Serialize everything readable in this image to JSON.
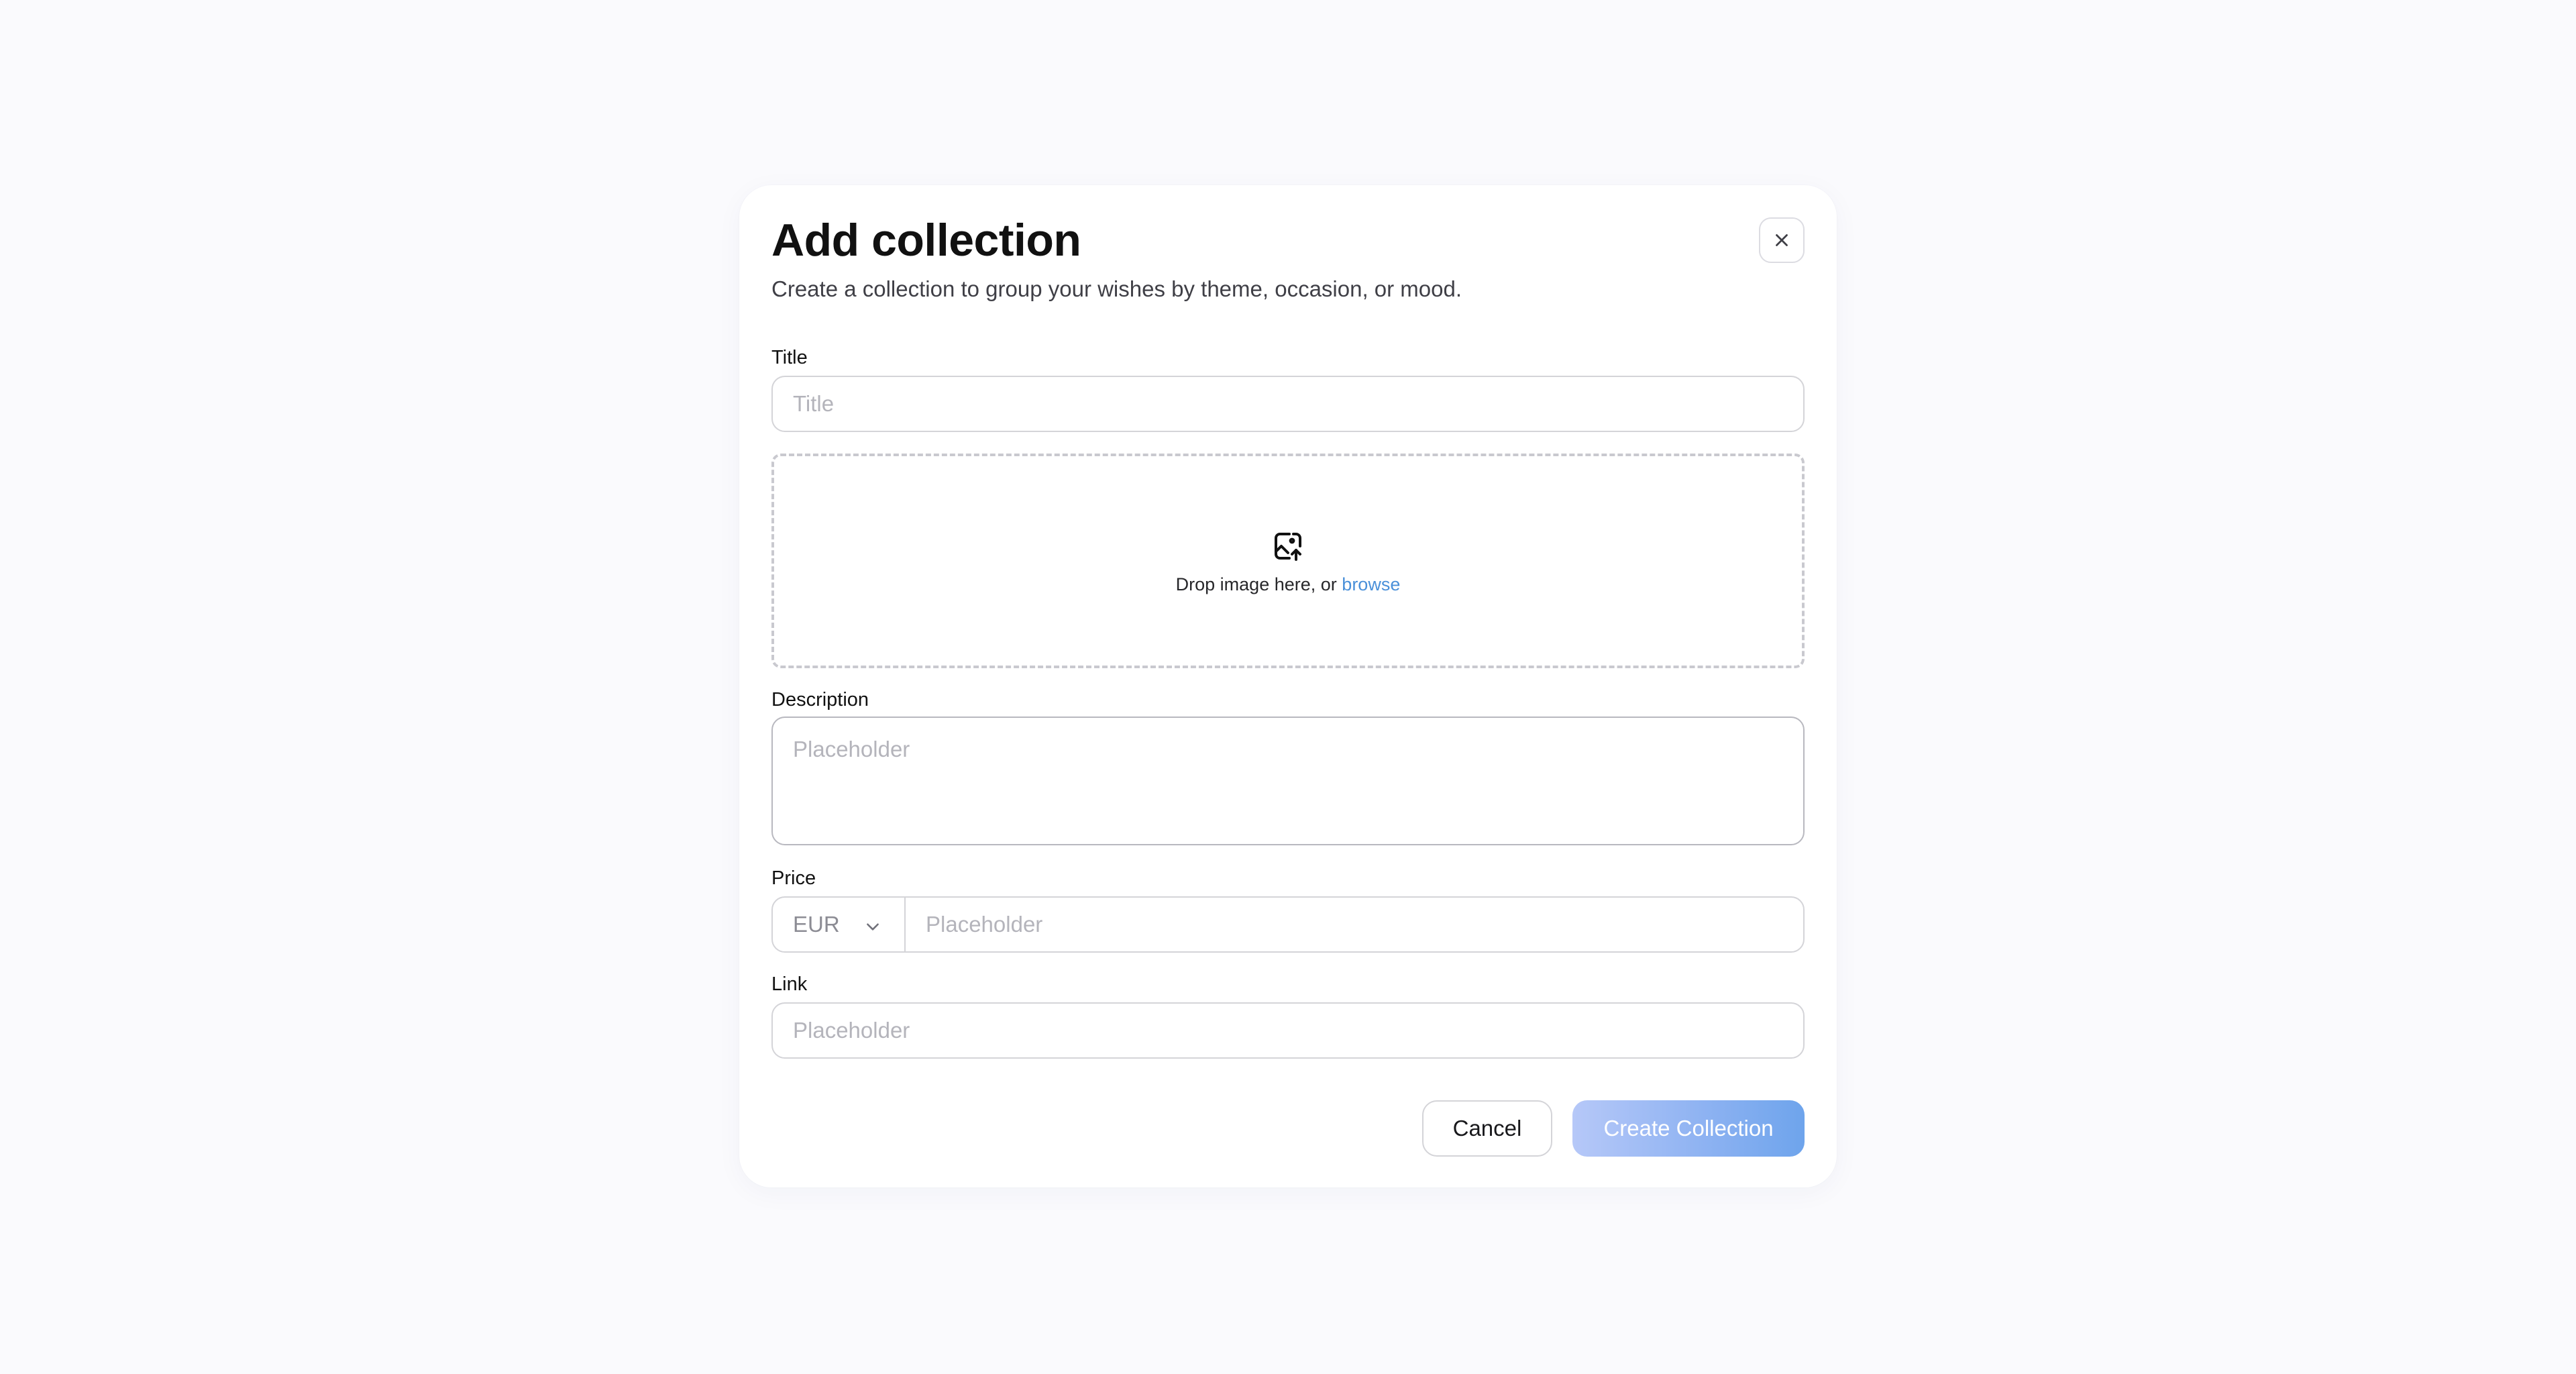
{
  "modal": {
    "title": "Add collection",
    "subtitle": "Create a collection to group your wishes by theme, occasion, or mood.",
    "close_icon": "close-icon"
  },
  "form": {
    "title_field": {
      "label": "Title",
      "placeholder": "Title",
      "value": ""
    },
    "image_upload": {
      "icon": "image-upload-icon",
      "prompt": "Drop image here, or",
      "browse_label": "browse"
    },
    "description_field": {
      "label": "Description",
      "placeholder": "Placeholder",
      "value": ""
    },
    "price_field": {
      "label": "Price",
      "currency": "EUR",
      "currency_icon": "chevron-down-icon",
      "placeholder": "Placeholder",
      "value": ""
    },
    "link_field": {
      "label": "Link",
      "placeholder": "Placeholder",
      "value": ""
    }
  },
  "actions": {
    "cancel_label": "Cancel",
    "create_label": "Create Collection"
  },
  "colors": {
    "background": "#fafafd",
    "link_accent": "#4a90d9",
    "primary_gradient_start": "#b6c8f8",
    "primary_gradient_end": "#6ea4ec"
  }
}
